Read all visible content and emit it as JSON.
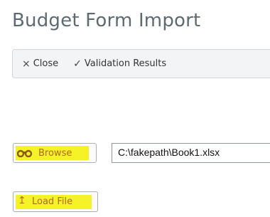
{
  "page": {
    "title": "Budget Form Import"
  },
  "toolbar": {
    "close_icon": "×",
    "close_label": "Close",
    "validation_icon": "✓",
    "validation_label": "Validation Results"
  },
  "browse": {
    "label": "Browse",
    "icon": "binoculars-icon"
  },
  "file_path": {
    "value": "C:\\fakepath\\Book1.xlsx"
  },
  "load": {
    "icon_glyph": "↥",
    "label": "Load File"
  },
  "colors": {
    "highlight": "#f6f228",
    "button_text": "#b06a1a",
    "title_text": "#5e6a72",
    "toolbar_bg": "#f3f4f5"
  }
}
